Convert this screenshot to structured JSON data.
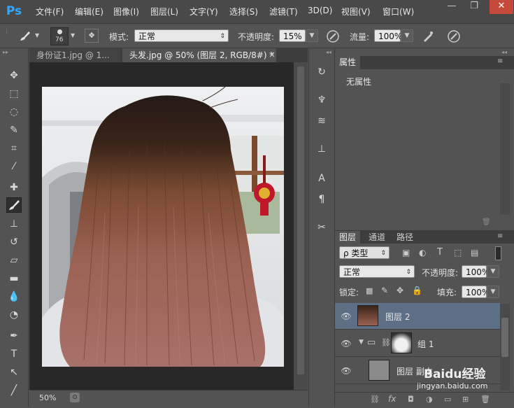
{
  "app": {
    "logo": "Ps"
  },
  "menu": [
    "文件(F)",
    "编辑(E)",
    "图像(I)",
    "图层(L)",
    "文字(Y)",
    "选择(S)",
    "滤镜(T)",
    "3D(D)",
    "视图(V)",
    "窗口(W)"
  ],
  "window_controls": {
    "minimize": "—",
    "restore": "❐",
    "close": "✕"
  },
  "options": {
    "brush_size": "76",
    "mode_label": "模式:",
    "mode_value": "正常",
    "opacity_label": "不透明度:",
    "opacity_value": "15%",
    "flow_label": "流量:",
    "flow_value": "100%"
  },
  "tabs": [
    {
      "label": "身份证1.jpg @ 1...",
      "active": false
    },
    {
      "label": "头发.jpg @ 50% (图层 2, RGB/8#) *",
      "active": true
    }
  ],
  "tab_close": "×",
  "status": {
    "zoom": "50%"
  },
  "properties": {
    "tab": "属性",
    "content": "无属性"
  },
  "layers_panel": {
    "tabs": [
      "图层",
      "通道",
      "路径"
    ],
    "filter_label": "ρ 类型",
    "blend_mode": "正常",
    "opacity_label": "不透明度:",
    "opacity_value": "100%",
    "lock_label": "锁定:",
    "fill_label": "填充:",
    "fill_value": "100%",
    "layers": [
      {
        "name": "图层 2",
        "selected": true
      },
      {
        "name": "组 1",
        "selected": false
      },
      {
        "name": "图层 副本",
        "selected": false
      }
    ]
  },
  "watermark": {
    "text": "Baidu经验",
    "url": "jingyan.baidu.com"
  },
  "colors": {
    "accent": "#31a8ff",
    "selected_layer": "#5c6f85",
    "canvas_bg": "#282828",
    "panel_bg": "#535353"
  }
}
